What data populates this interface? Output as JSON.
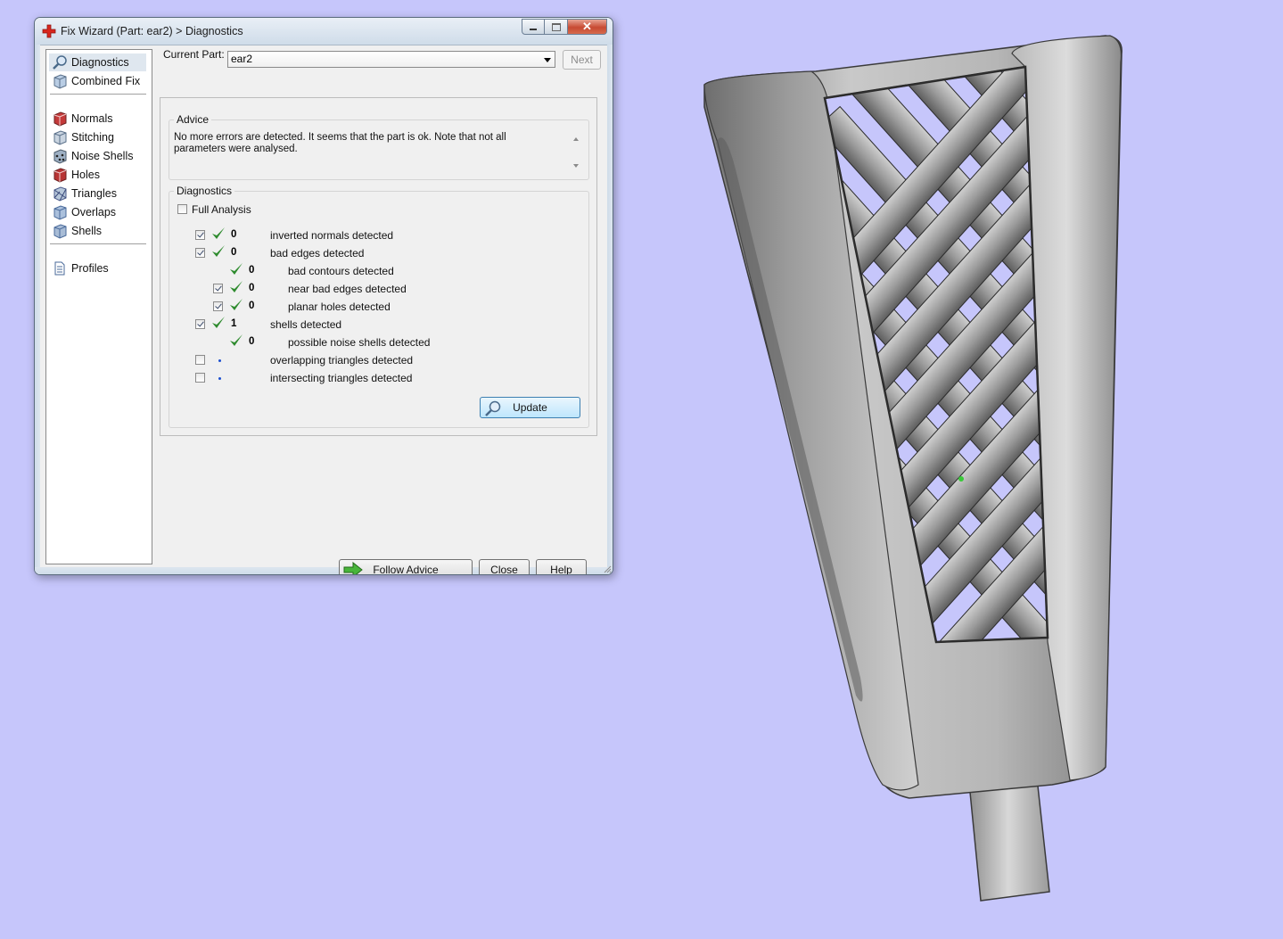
{
  "window": {
    "title": "Fix Wizard (Part: ear2) > Diagnostics",
    "close_glyph": "✕"
  },
  "sidebar": {
    "items": [
      {
        "label": "Diagnostics",
        "icon": "magnifier-icon",
        "selected": true
      },
      {
        "label": "Combined Fix",
        "icon": "cube-icon"
      },
      {
        "label": "Normals",
        "icon": "red-cube-icon"
      },
      {
        "label": "Stitching",
        "icon": "cube-icon"
      },
      {
        "label": "Noise Shells",
        "icon": "dots-cube-icon"
      },
      {
        "label": "Holes",
        "icon": "red-cube-icon"
      },
      {
        "label": "Triangles",
        "icon": "triangle-cube-icon"
      },
      {
        "label": "Overlaps",
        "icon": "cube-icon"
      },
      {
        "label": "Shells",
        "icon": "cube-icon"
      },
      {
        "label": "Profiles",
        "icon": "document-icon"
      }
    ]
  },
  "part": {
    "label": "Current Part:",
    "value": "ear2",
    "next_label": "Next"
  },
  "advice": {
    "title": "Advice",
    "text": "No more errors are detected. It seems that the part is ok. Note that not all parameters were analysed."
  },
  "diagnostics": {
    "title": "Diagnostics",
    "full_analysis_label": "Full Analysis",
    "full_analysis_checked": false,
    "rows": [
      {
        "count": "0",
        "label": "inverted normals detected",
        "checked": true,
        "ok": true
      },
      {
        "count": "0",
        "label": "bad edges detected",
        "checked": true,
        "ok": true
      },
      {
        "count": "0",
        "label": "bad contours detected",
        "ok": true
      },
      {
        "count": "0",
        "label": "near bad edges detected",
        "checked": true,
        "ok": true
      },
      {
        "count": "0",
        "label": "planar holes detected",
        "checked": true,
        "ok": true
      },
      {
        "count": "1",
        "label": "shells detected",
        "checked": true,
        "ok": true
      },
      {
        "count": "0",
        "label": "possible noise shells detected",
        "ok": true
      },
      {
        "count": "",
        "label": "overlapping triangles detected",
        "checked": false,
        "ok": false
      },
      {
        "count": "",
        "label": "intersecting triangles detected",
        "checked": false,
        "ok": false
      }
    ],
    "update_label": "Update"
  },
  "footer": {
    "follow_advice_label": "Follow Advice",
    "close_label": "Close",
    "help_label": "Help"
  },
  "colors": {
    "viewport_background": "#c6c6fb",
    "check_green": "#2e8b2e",
    "model_grey": "#8e8e8e"
  }
}
